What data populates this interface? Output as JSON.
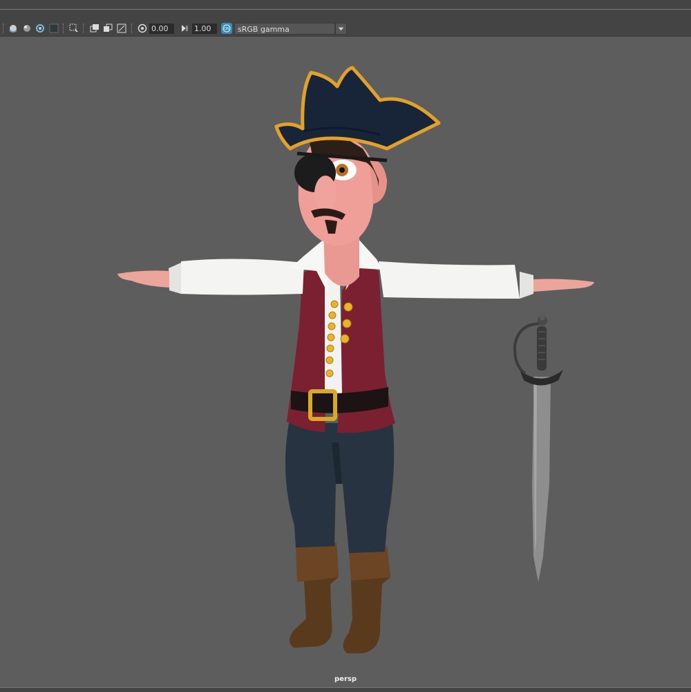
{
  "toolbar": {
    "exposure_value": "0.00",
    "gamma_value": "1.00",
    "color_space": "sRGB gamma",
    "icons": [
      "shading-sphere-icon",
      "lighting-sphere-icon",
      "isolate-select-icon",
      "xray-icon",
      "select-camera-icon",
      "grid-icon",
      "resolution-gate-icon",
      "film-gate-icon",
      "exposure-icon",
      "gamma-icon",
      "color-management-icon",
      "dropdown-arrow-icon"
    ]
  },
  "viewport": {
    "camera_label": "persp",
    "background_color": "#5d5d5d"
  },
  "scene": {
    "subject": "cartoon pirate character in T-pose with cutlass"
  }
}
